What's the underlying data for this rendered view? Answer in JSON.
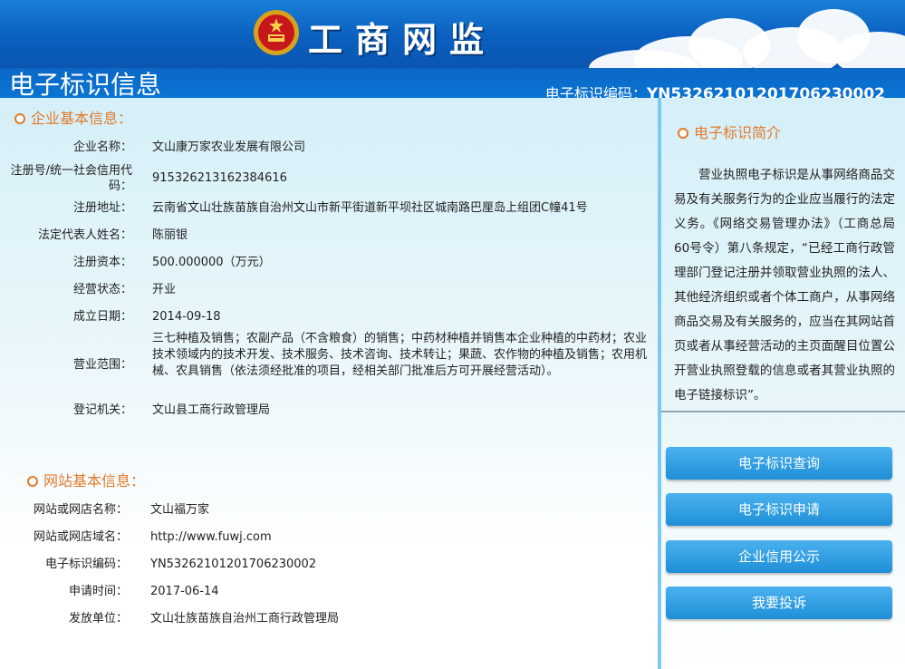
{
  "header": {
    "banner_title": "工商网监",
    "page_title": "电子标识信息",
    "code_label": "电子标识编码：",
    "code_value": "YN53262101201706230002"
  },
  "enterprise": {
    "section_title": "企业基本信息：",
    "fields": [
      {
        "label": "企业名称：",
        "value": "文山康万家农业发展有限公司"
      },
      {
        "label": "注册号/统一社会信用代码：",
        "value": "91532621316238461​6"
      },
      {
        "label": "注册地址：",
        "value": "云南省文山壮族苗族自治州文山市新平街道新平坝社区城南路巴厘岛上组团C幢41号"
      },
      {
        "label": "法定代表人姓名：",
        "value": "陈丽银"
      },
      {
        "label": "注册资本：",
        "value": "500.000000（万元）"
      },
      {
        "label": "经营状态：",
        "value": "开业"
      },
      {
        "label": "成立日期：",
        "value": "2014-09-18"
      },
      {
        "label": "营业范围：",
        "value": "三七种植及销售；农副产品（不含粮食）的销售；中药材种植并销售本企业种植的中药材；农业技术领域内的技术开发、技术服务、技术咨询、技术转让；果蔬、农作物的种植及销售；农用机械、农具销售（依法须经批准的项目，经相关部门批准后方可开展经营活动）。"
      },
      {
        "label": "登记机关：",
        "value": "文山县工商行政管理局"
      }
    ]
  },
  "website": {
    "section_title": "网站基本信息：",
    "fields": [
      {
        "label": "网站或网店名称：",
        "value": "文山福万家"
      },
      {
        "label": "网站或网店域名：",
        "value": "http://www.fuwj.com"
      },
      {
        "label": "电子标识编码：",
        "value": "YN53262101201706230002"
      },
      {
        "label": "申请时间：",
        "value": "2017-06-14"
      },
      {
        "label": "发放单位：",
        "value": "文山壮族苗族自治州工商行政管理局"
      }
    ]
  },
  "sidebar": {
    "section_title": "电子标识简介",
    "intro": "营业执照电子标识是从事网络商品交易及有关服务行为的企业应当履行的法定义务。《网络交易管理办法》（工商总局60号令）第八条规定，“已经工商行政管理部门登记注册并领取营业执照的法人、其他经济组织或者个体工商户，从事网络商品交易及有关服务的，应当在其网站首页或者从事经营活动的主页面醒目位置公开营业执照登载的信息或者其营业执照的电子链接标识”。",
    "buttons": [
      "电子标识查询",
      "电子标识申请",
      "企业信用公示",
      "我要投诉"
    ]
  }
}
